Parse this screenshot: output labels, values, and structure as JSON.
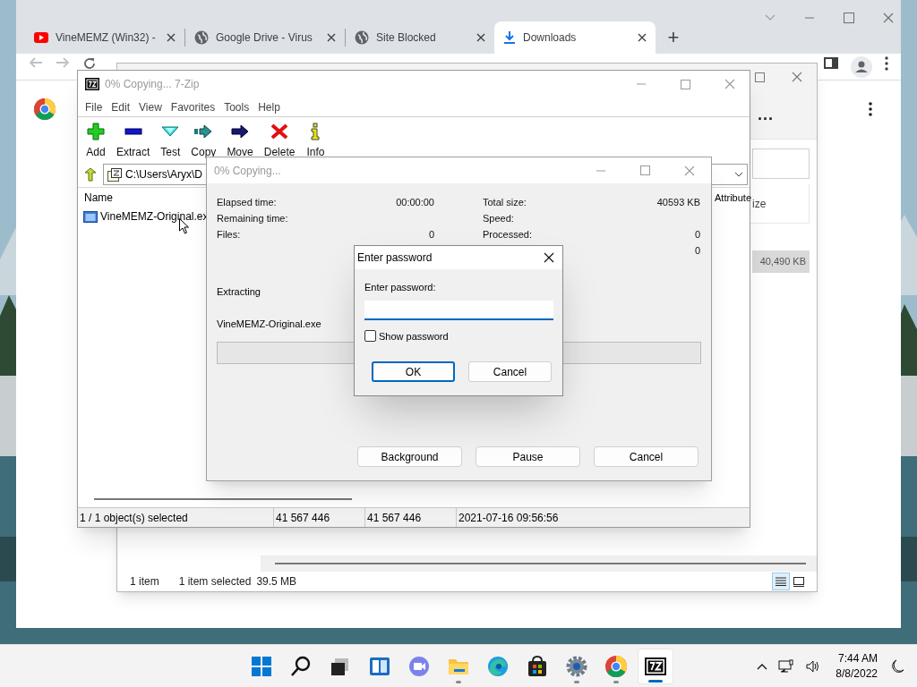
{
  "browser": {
    "tabs": [
      {
        "kind": "video",
        "title": "VineMEMZ (Win32) -",
        "selected": false
      },
      {
        "kind": "web",
        "title": "Google Drive - Virus",
        "selected": false
      },
      {
        "kind": "web",
        "title": "Site Blocked",
        "selected": false
      },
      {
        "kind": "download",
        "title": "Downloads",
        "selected": true
      }
    ],
    "new_tab": "+"
  },
  "explorer": {
    "more": "...",
    "column": "ize",
    "selected_size": "40,490 KB",
    "status": {
      "count": "1 item",
      "selection": "1 item selected",
      "size": "39.5 MB"
    }
  },
  "seven_zip": {
    "title": "0% Copying... 7-Zip",
    "menu": [
      "File",
      "Edit",
      "View",
      "Favorites",
      "Tools",
      "Help"
    ],
    "toolbar": [
      {
        "kind": "add",
        "label": "Add"
      },
      {
        "kind": "extract",
        "label": "Extract"
      },
      {
        "kind": "test",
        "label": "Test"
      },
      {
        "kind": "copy",
        "label": "Copy"
      },
      {
        "kind": "move",
        "label": "Move"
      },
      {
        "kind": "delete",
        "label": "Delete"
      },
      {
        "kind": "info",
        "label": "Info"
      }
    ],
    "path": "C:\\Users\\Aryx\\D",
    "columns": {
      "name": "Name",
      "attributes": "Attribute"
    },
    "files": [
      {
        "name": "VineMEMZ-Original.ex"
      }
    ],
    "status": [
      "1 / 1 object(s) selected",
      "41 567 446",
      "41 567 446",
      "2021-07-16 09:56:56"
    ]
  },
  "progress_dialog": {
    "title": "0% Copying...",
    "left_stats": [
      {
        "label": "Elapsed time:",
        "value": "00:00:00"
      },
      {
        "label": "Remaining time:"
      },
      {
        "label": "Files:",
        "value": "0"
      }
    ],
    "right_stats": [
      {
        "label": "Total size:",
        "value": "40593 KB"
      },
      {
        "label": "Speed:"
      },
      {
        "label": "Processed:",
        "value": "0"
      },
      {
        "value": "0"
      }
    ],
    "operation": "Extracting",
    "file": "VineMEMZ-Original.exe",
    "level": 0,
    "buttons": [
      "Background",
      "Pause",
      "Cancel"
    ]
  },
  "password_dialog": {
    "title": "Enter password",
    "label": "Enter password:",
    "show_password": {
      "label": "Show password",
      "checked": false
    },
    "buttons": [
      {
        "label": "OK",
        "default": true
      },
      {
        "label": "Cancel",
        "default": false
      }
    ]
  },
  "taskbar": {
    "apps": [
      {
        "kind": "start",
        "running": false,
        "selected": false
      },
      {
        "kind": "search",
        "running": false,
        "selected": false
      },
      {
        "kind": "task-view",
        "running": false,
        "selected": false
      },
      {
        "kind": "widgets",
        "running": false,
        "selected": false
      },
      {
        "kind": "chat",
        "running": false,
        "selected": false
      },
      {
        "kind": "files",
        "running": true,
        "selected": false
      },
      {
        "kind": "edge",
        "running": false,
        "selected": false
      },
      {
        "kind": "store",
        "running": false,
        "selected": false
      },
      {
        "kind": "settings",
        "running": true,
        "selected": false
      },
      {
        "kind": "chrome",
        "running": true,
        "selected": false
      },
      {
        "kind": "archiver",
        "running": true,
        "selected": true
      }
    ],
    "time": "7:44 AM",
    "date": "8/8/2022"
  }
}
